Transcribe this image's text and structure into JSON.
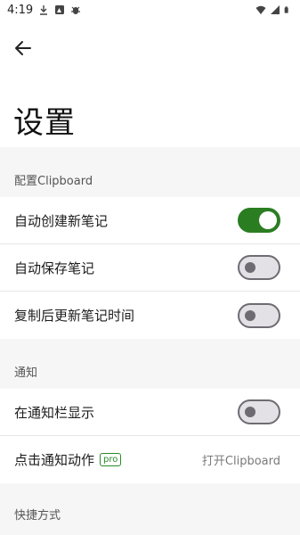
{
  "status_bar": {
    "time": "4:19",
    "left_icons": [
      "download-icon",
      "image-notification-icon",
      "bug-icon"
    ],
    "right_icons": [
      "wifi-icon",
      "signal-icon",
      "battery-icon"
    ]
  },
  "header": {
    "back_icon": "arrow-left-icon",
    "title": "设置"
  },
  "sections": [
    {
      "title": "配置Clipboard",
      "rows": [
        {
          "label": "自动创建新笔记",
          "toggle": "on"
        },
        {
          "label": "自动保存笔记",
          "toggle": "off"
        },
        {
          "label": "复制后更新笔记时间",
          "toggle": "off"
        }
      ]
    },
    {
      "title": "通知",
      "rows": [
        {
          "label": "在通知栏显示",
          "toggle": "off"
        },
        {
          "label": "点击通知动作",
          "badge": "pro",
          "value": "打开Clipboard"
        }
      ]
    },
    {
      "title": "快捷方式"
    }
  ],
  "colors": {
    "accent": "#2b7d22",
    "switch_off_track": "#e4e1e6",
    "switch_off_border": "#6f6b73",
    "background": "#f6f6f6"
  }
}
